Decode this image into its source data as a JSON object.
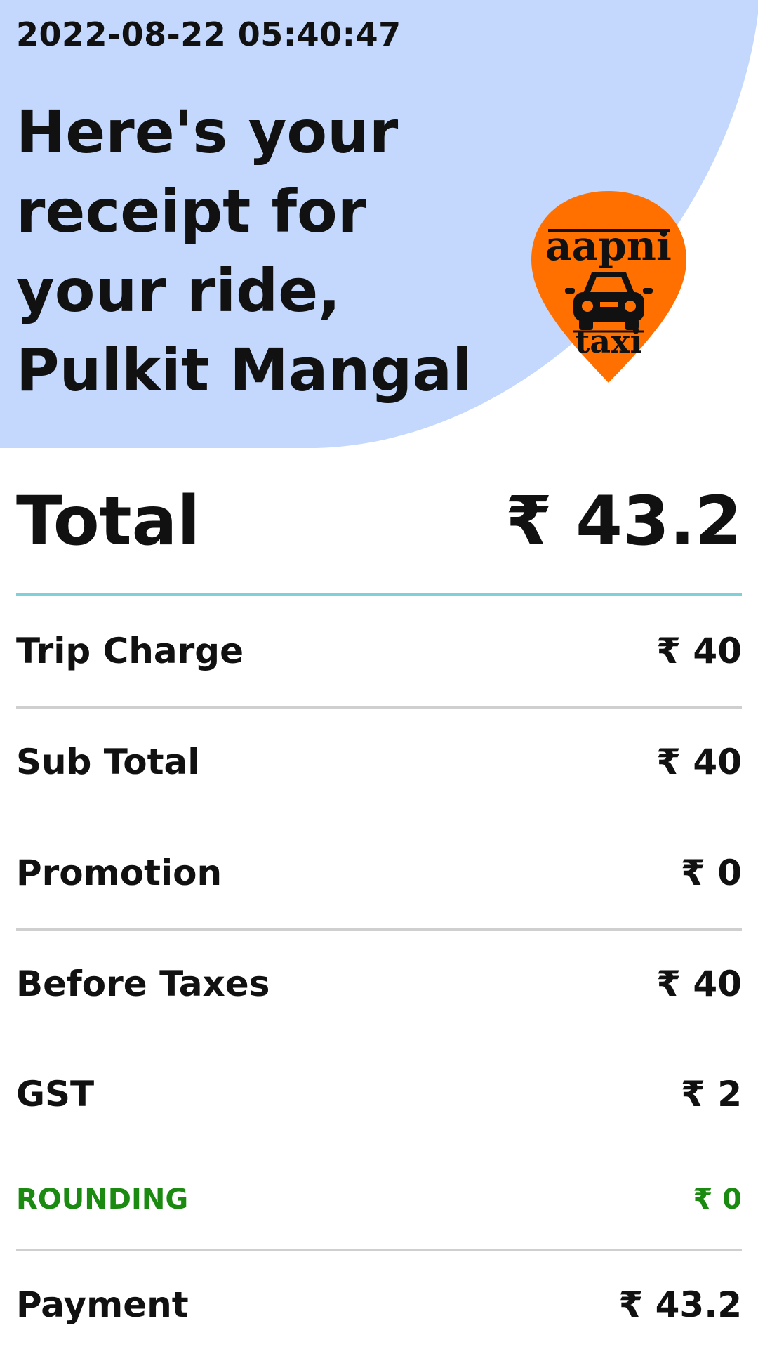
{
  "header": {
    "timestamp": "2022-08-22 05:40:47",
    "headline_lines": [
      "Here's your",
      "receipt for",
      "your ride,",
      "Pulkit Mangal"
    ],
    "background_color": "#c4d8fd"
  },
  "logo": {
    "name": "aapni taxi",
    "word_top": "aapni",
    "word_bottom": "taxi",
    "color": "#ff7000"
  },
  "total": {
    "label": "Total",
    "value": "₹ 43.2"
  },
  "breakdown": [
    {
      "label": "Trip Charge",
      "value": "₹ 40"
    },
    {
      "label": "Sub Total",
      "value": "₹ 40"
    },
    {
      "label": "Promotion",
      "value": "₹ 0"
    },
    {
      "label": "Before Taxes",
      "value": "₹ 40"
    },
    {
      "label": "GST",
      "value": "₹ 2"
    },
    {
      "label": "ROUNDING",
      "value": "₹ 0",
      "color": "#1a8a10"
    },
    {
      "label": "Payment",
      "value": "₹ 43.2"
    }
  ],
  "colors": {
    "total_divider": "#7fd0d8",
    "row_divider": "#cfcfcf",
    "rounding": "#1a8a10"
  }
}
